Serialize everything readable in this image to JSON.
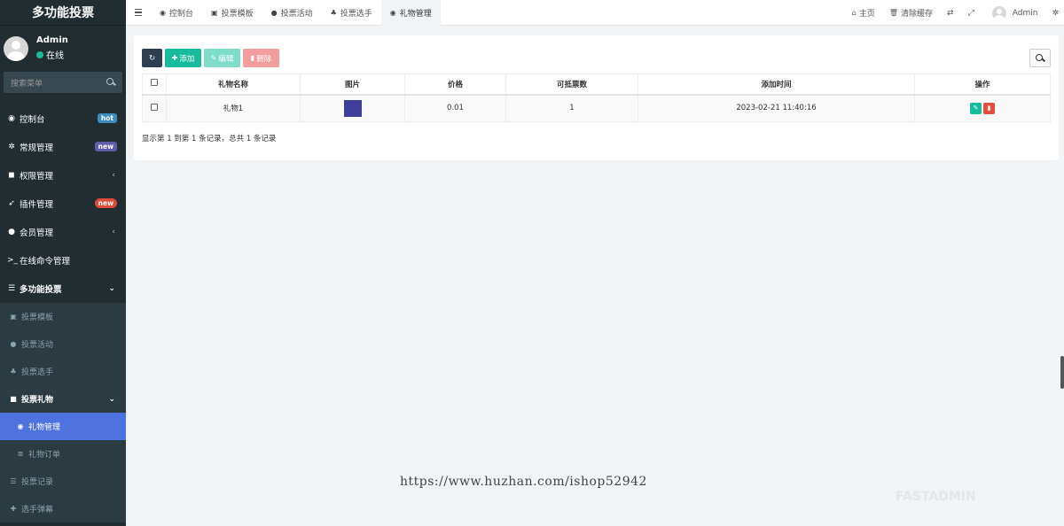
{
  "brand": "多功能投票",
  "user": {
    "name": "Admin",
    "status": "在线"
  },
  "sidebar_search_placeholder": "搜索菜单",
  "menu": [
    {
      "icon": "dashboard-icon",
      "glyph": "◉",
      "label": "控制台",
      "badge": "hot"
    },
    {
      "icon": "cogs-icon",
      "glyph": "✲",
      "label": "常规管理",
      "badge": "new"
    },
    {
      "icon": "group-icon",
      "glyph": "◼",
      "label": "权限管理",
      "chevron": "‹"
    },
    {
      "icon": "rocket-icon",
      "glyph": "➶",
      "label": "插件管理",
      "badge": "new"
    },
    {
      "icon": "user-circle-icon",
      "glyph": "●",
      "label": "会员管理",
      "chevron": "‹"
    },
    {
      "icon": "terminal-icon",
      "glyph": ">_",
      "label": "在线命令管理"
    },
    {
      "icon": "list-icon",
      "glyph": "☰",
      "label": "多功能投票",
      "chevron": "⌄"
    }
  ],
  "submenu": [
    {
      "icon": "template-icon",
      "glyph": "▣",
      "label": "投票模板"
    },
    {
      "icon": "bomb-icon",
      "glyph": "●",
      "label": "投票活动"
    },
    {
      "icon": "user-plus-icon",
      "glyph": "♣",
      "label": "投票选手"
    },
    {
      "icon": "gift-icon",
      "glyph": "■",
      "label": "投票礼物",
      "chevron": "⌄"
    }
  ],
  "subsub": [
    {
      "icon": "gift-manage-icon",
      "glyph": "◉",
      "label": "礼物管理"
    },
    {
      "icon": "order-list-icon",
      "glyph": "≣",
      "label": "礼物订单"
    }
  ],
  "sub_after": [
    {
      "icon": "record-list-icon",
      "glyph": "☰",
      "label": "投票记录"
    },
    {
      "icon": "move-icon",
      "glyph": "✚",
      "label": "选手弹幕"
    }
  ],
  "tabs": [
    {
      "icon": "dashboard-icon",
      "glyph": "◉",
      "label": "控制台"
    },
    {
      "icon": "template-icon",
      "glyph": "▣",
      "label": "投票模板"
    },
    {
      "icon": "bomb-icon",
      "glyph": "●",
      "label": "投票活动"
    },
    {
      "icon": "user-plus-icon",
      "glyph": "♣",
      "label": "投票选手"
    },
    {
      "icon": "gift-manage-icon",
      "glyph": "◉",
      "label": "礼物管理"
    }
  ],
  "nav_right": {
    "home": "主页",
    "clear_cache": "清除缓存",
    "admin": "Admin"
  },
  "toolbar": {
    "add": "添加",
    "edit": "编辑",
    "delete": "删除"
  },
  "table": {
    "headers": [
      "礼物名称",
      "图片",
      "价格",
      "可抵票数",
      "添加时间",
      "操作"
    ],
    "rows": [
      {
        "name": "礼物1",
        "price": "0.01",
        "votes": "1",
        "time": "2023-02-21 11:40:16",
        "image_color": "#3f3f9b"
      }
    ]
  },
  "pager_info": "显示第 1 到第 1 条记录，总共 1 条记录",
  "watermark": "https://www.huzhan.com/ishop52942",
  "watermark_logo": "FASTADMIN"
}
